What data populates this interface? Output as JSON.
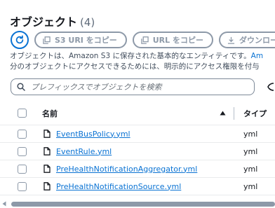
{
  "header": {
    "title": "オブジェクト",
    "count": "(4)"
  },
  "toolbar": {
    "copy_s3_uri": "S3 URI をコピー",
    "copy_url": "URL をコピー",
    "download": "ダウンロー"
  },
  "description": {
    "line1": "オブジェクトは、Amazon S3 に保存された基本的なエンティティです。",
    "line1_link": "Am",
    "line2": "分のオブジェクトにアクセスできるためには、明示的にアクセス権限を付与"
  },
  "search": {
    "placeholder": "プレフィックスでオブジェクトを検索"
  },
  "table": {
    "columns": {
      "name": "名前",
      "type": "タイプ"
    },
    "rows": [
      {
        "name": "EventBusPolicy.yml",
        "type": "yml"
      },
      {
        "name": "EventRule.yml",
        "type": "yml"
      },
      {
        "name": "PreHealthNotificationAggregator.yml",
        "type": "yml"
      },
      {
        "name": "PreHealthNotificationSource.yml",
        "type": "yml"
      }
    ]
  },
  "colors": {
    "accent": "#0972d3",
    "disabled": "#8d99a8",
    "text": "#16191f"
  },
  "icons": [
    "refresh-icon",
    "copy-icon",
    "download-icon",
    "search-icon",
    "sort-up-icon",
    "file-icon",
    "chevron-left-icon"
  ]
}
